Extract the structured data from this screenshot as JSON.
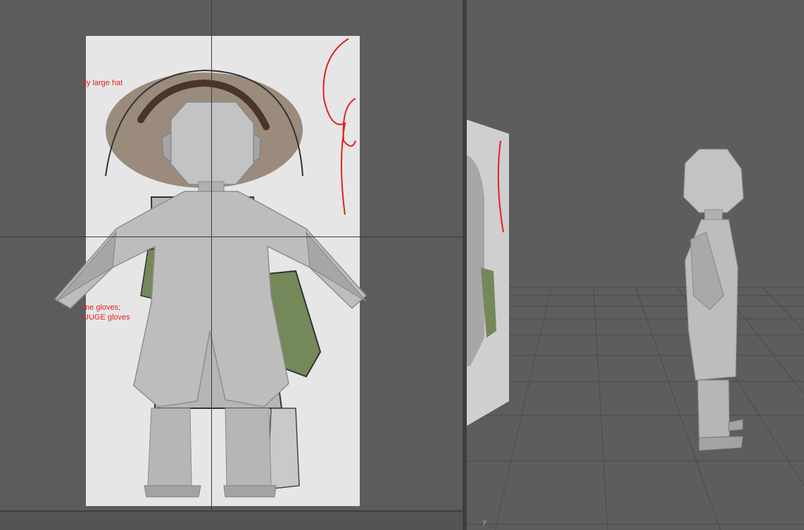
{
  "front_view": {
    "notes": [
      {
        "id": "note-hat",
        "text": "lly large hat"
      },
      {
        "id": "note-gloves",
        "text": "me gloves;\nUUGE gloves"
      }
    ]
  },
  "perspective_view": {
    "axis_label": "y"
  },
  "colors": {
    "viewport_bg": "#5c5c5c",
    "grid_line": "#4a4a4a",
    "mesh_light": "#bdbdbd",
    "mesh_dark": "#8a8a8a",
    "sketch_red": "#e0231c",
    "glove_green": "#74885a",
    "hat_brown": "#8c7a6a"
  }
}
